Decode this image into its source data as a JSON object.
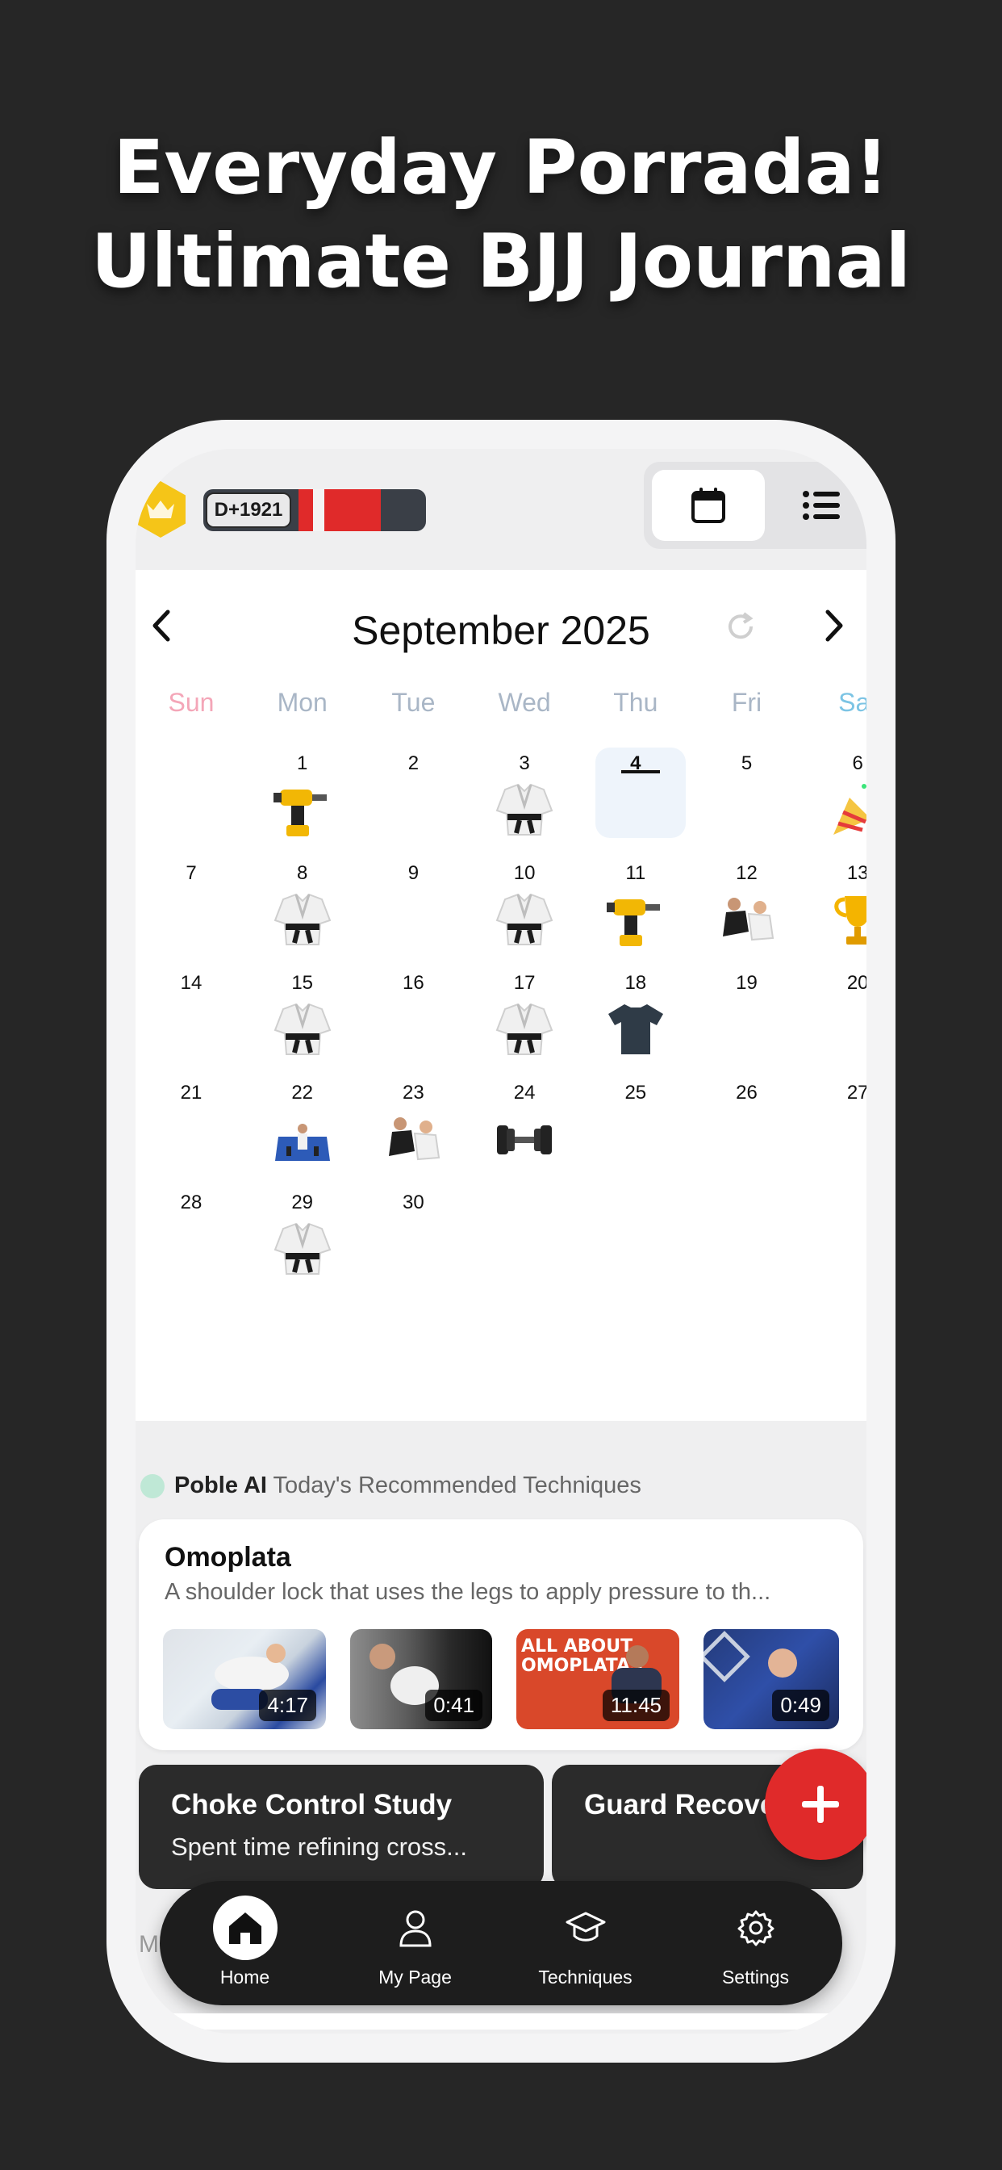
{
  "headline": {
    "line1": "Everyday Porrada!",
    "line2": "Ultimate BJJ Journal"
  },
  "topbar": {
    "streak_label": "D+1921",
    "crown_icon": "crown-icon",
    "view_calendar_icon": "calendar-icon",
    "view_list_icon": "list-icon"
  },
  "calendar": {
    "month": "September 2025",
    "weekdays": [
      "Sun",
      "Mon",
      "Tue",
      "Wed",
      "Thu",
      "Fri",
      "Sat"
    ],
    "weekday_colors": {
      "Sun": "#f4a6b8",
      "Sat": "#7cc4e4",
      "default": "#a9b6c6"
    },
    "today": "4",
    "days": [
      {
        "n": "1",
        "icon": "drill"
      },
      {
        "n": "2",
        "icon": ""
      },
      {
        "n": "3",
        "icon": "gi"
      },
      {
        "n": "4",
        "icon": ""
      },
      {
        "n": "5",
        "icon": ""
      },
      {
        "n": "6",
        "icon": "party"
      },
      {
        "n": "7",
        "icon": ""
      },
      {
        "n": "8",
        "icon": "gi"
      },
      {
        "n": "9",
        "icon": ""
      },
      {
        "n": "10",
        "icon": "gi"
      },
      {
        "n": "11",
        "icon": "drill"
      },
      {
        "n": "12",
        "icon": "sparring"
      },
      {
        "n": "13",
        "icon": "trophy"
      },
      {
        "n": "14",
        "icon": ""
      },
      {
        "n": "15",
        "icon": "gi"
      },
      {
        "n": "16",
        "icon": ""
      },
      {
        "n": "17",
        "icon": "gi"
      },
      {
        "n": "18",
        "icon": "tshirt"
      },
      {
        "n": "19",
        "icon": ""
      },
      {
        "n": "20",
        "icon": ""
      },
      {
        "n": "21",
        "icon": ""
      },
      {
        "n": "22",
        "icon": "mat"
      },
      {
        "n": "23",
        "icon": "sparring"
      },
      {
        "n": "24",
        "icon": "dumbbell"
      },
      {
        "n": "25",
        "icon": ""
      },
      {
        "n": "26",
        "icon": ""
      },
      {
        "n": "27",
        "icon": ""
      },
      {
        "n": "28",
        "icon": ""
      },
      {
        "n": "29",
        "icon": "gi"
      },
      {
        "n": "30",
        "icon": ""
      }
    ]
  },
  "ai": {
    "name": "Poble AI",
    "subtitle": "Today's Recommended Techniques"
  },
  "technique": {
    "title": "Omoplata",
    "description": "A shoulder lock that uses the legs to apply pressure to th...",
    "videos": [
      {
        "duration": "4:17"
      },
      {
        "duration": "0:41"
      },
      {
        "duration": "11:45",
        "overlay": "ALL ABOUT OMOPLATAS"
      },
      {
        "duration": "0:49"
      }
    ]
  },
  "journals": [
    {
      "title": "Choke Control Study",
      "desc": "Spent time refining cross..."
    },
    {
      "title": "Guard Recove",
      "desc": ""
    }
  ],
  "section_label": "M",
  "tabs": [
    {
      "label": "Home",
      "icon": "home-icon"
    },
    {
      "label": "My Page",
      "icon": "person-icon"
    },
    {
      "label": "Techniques",
      "icon": "graduation-cap-icon"
    },
    {
      "label": "Settings",
      "icon": "gear-icon"
    }
  ]
}
